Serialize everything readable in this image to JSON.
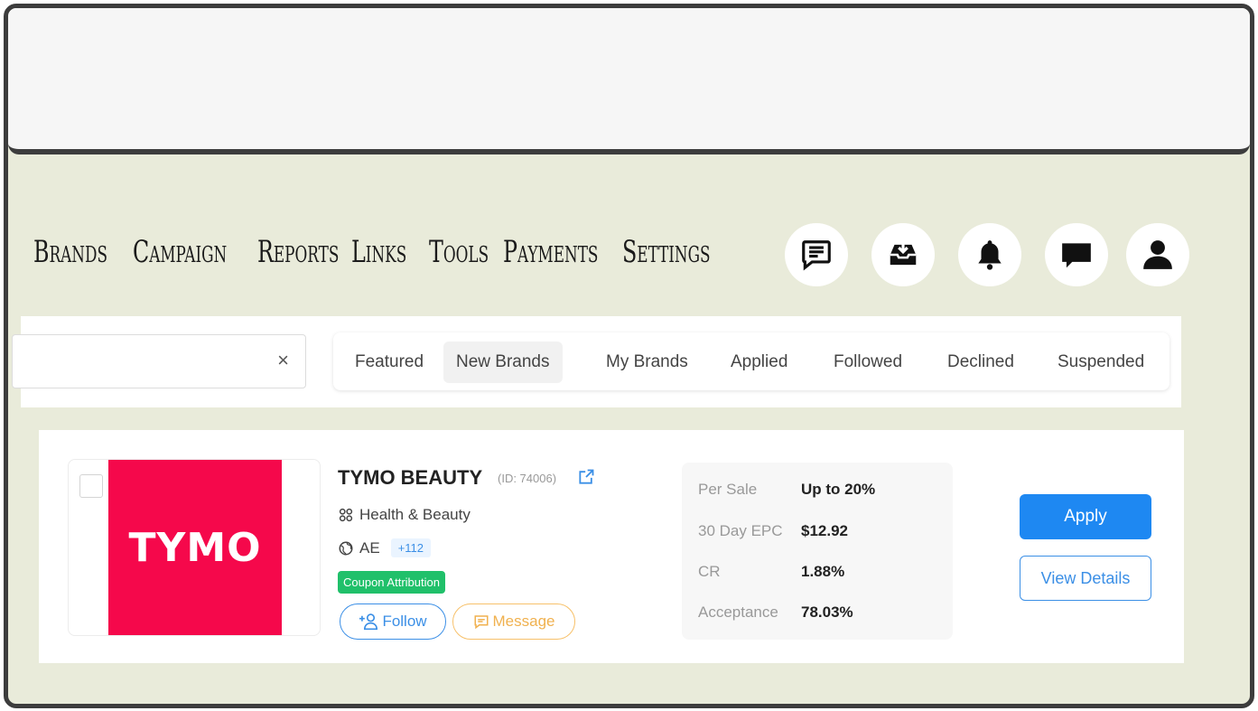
{
  "nav": {
    "items": [
      "Brands",
      "Campaign",
      "Reports",
      "Links",
      "Tools",
      "Payments",
      "Settings"
    ]
  },
  "header_icons": [
    "feedback-icon",
    "inbox-download-icon",
    "bell-icon",
    "chat-icon",
    "user-icon"
  ],
  "search": {
    "value": "",
    "clear_label": "×"
  },
  "tabs": [
    "Featured",
    "New Brands",
    "My Brands",
    "Applied",
    "Followed",
    "Declined",
    "Suspended"
  ],
  "active_tab": "New Brands",
  "brand": {
    "logo_text": "TYMO",
    "name": "TYMO BEAUTY",
    "id_label": "(ID: 74006)",
    "category": "Health & Beauty",
    "region": "AE",
    "region_more": "+112",
    "badge": "Coupon Attribution",
    "follow_label": "Follow",
    "message_label": "Message",
    "stats": [
      {
        "label": "Per Sale",
        "value": "Up to 20%"
      },
      {
        "label": "30 Day EPC",
        "value": "$12.92"
      },
      {
        "label": "CR",
        "value": "1.88%"
      },
      {
        "label": "Acceptance",
        "value": "78.03%"
      }
    ],
    "apply_label": "Apply",
    "details_label": "View Details"
  },
  "colors": {
    "frame_bg": "#e9ebda",
    "logo_bg": "#f5084b",
    "primary": "#1e88f2",
    "badge": "#20c06a",
    "message": "#f0b14f"
  }
}
